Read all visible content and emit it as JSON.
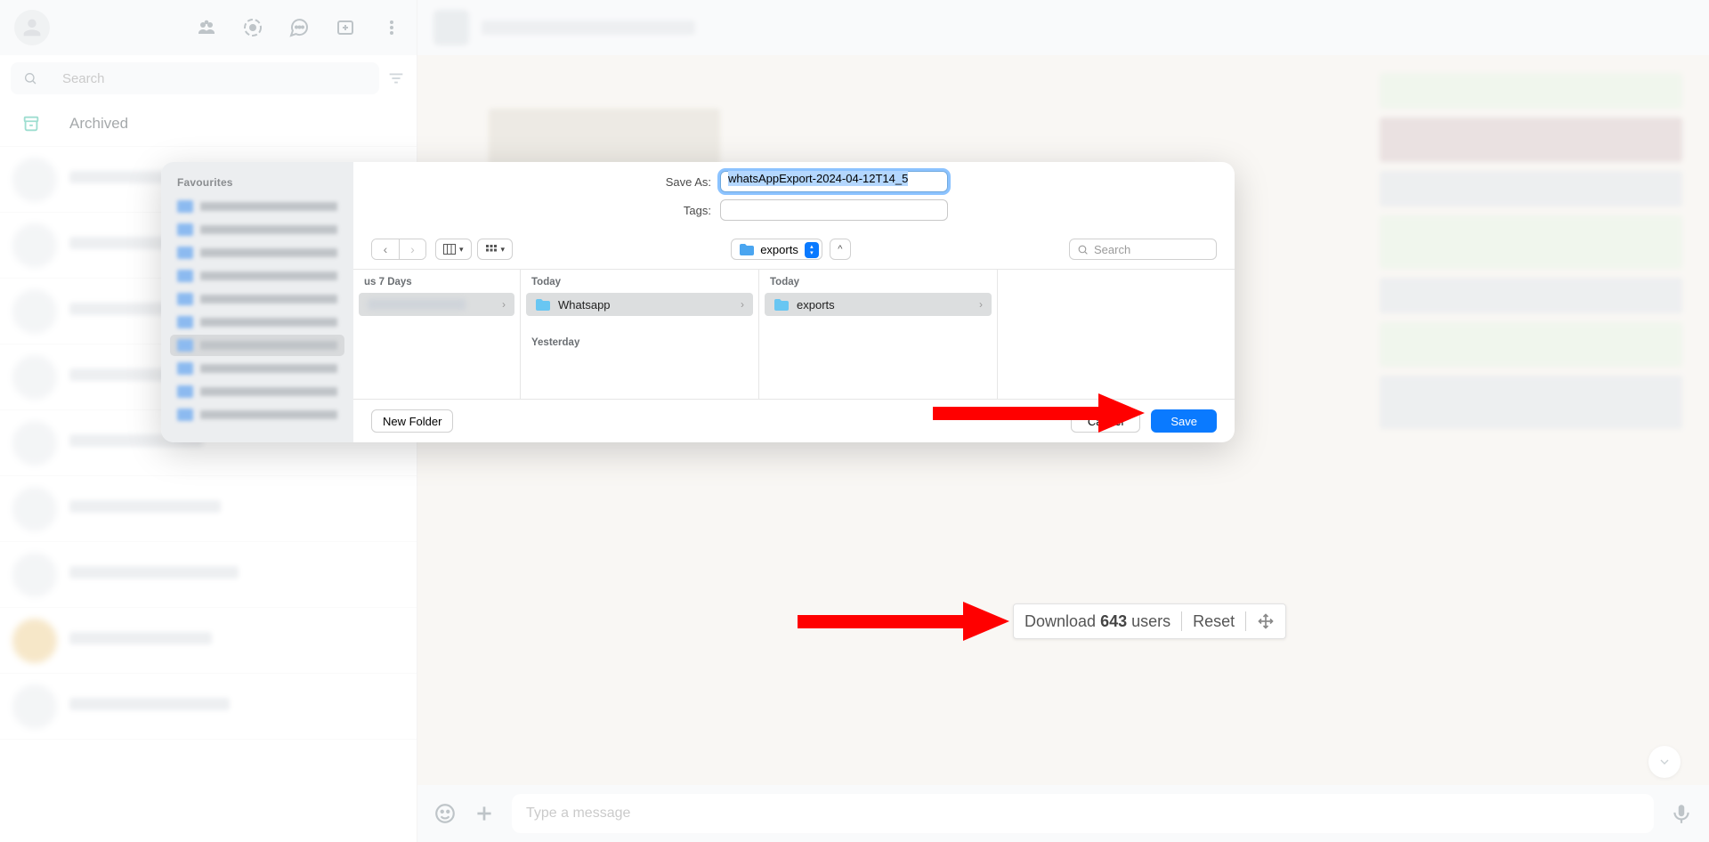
{
  "whatsapp": {
    "search_placeholder": "Search",
    "archived_label": "Archived",
    "compose_placeholder": "Type a message"
  },
  "save_dialog": {
    "save_as_label": "Save As:",
    "tags_label": "Tags:",
    "filename": "whatsAppExport-2024-04-12T14_5",
    "sidebar_title": "Favourites",
    "current_location": "exports",
    "search_placeholder": "Search",
    "columns": [
      {
        "header": "us 7 Days",
        "items": [
          {
            "name": "",
            "blurred": true
          }
        ]
      },
      {
        "header": "Today",
        "second_header": "Yesterday",
        "items": [
          {
            "name": "Whatsapp"
          }
        ]
      },
      {
        "header": "Today",
        "items": [
          {
            "name": "exports"
          }
        ]
      }
    ],
    "new_folder_label": "New Folder",
    "cancel_label": "Cancel",
    "save_label": "Save"
  },
  "bottom_bar": {
    "download_label": "Download",
    "count": "643",
    "users_label": "users",
    "reset_label": "Reset"
  }
}
